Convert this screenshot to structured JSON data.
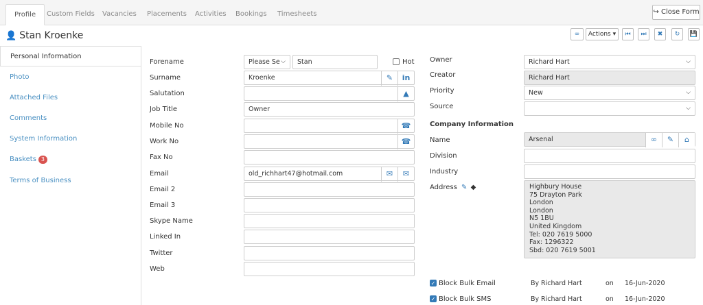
{
  "tabs": [
    "Profile",
    "Custom Fields",
    "Vacancies",
    "Placements",
    "Activities",
    "Bookings",
    "Timesheets"
  ],
  "close_form_label": "Close Form",
  "page_title": "Stan Kroenke",
  "actions_label": "Actions",
  "sidebar": {
    "items": [
      {
        "label": "Personal Information"
      },
      {
        "label": "Photo"
      },
      {
        "label": "Attached Files"
      },
      {
        "label": "Comments"
      },
      {
        "label": "System Information"
      },
      {
        "label": "Baskets",
        "badge": "3"
      },
      {
        "label": "Terms of Business"
      }
    ]
  },
  "form": {
    "forename_label": "Forename",
    "title_select": "Please Se",
    "forename_value": "Stan",
    "hot_label": "Hot",
    "surname_label": "Surname",
    "surname_value": "Kroenke",
    "salutation_label": "Salutation",
    "job_title_label": "Job Title",
    "job_title_value": "Owner",
    "mobile_label": "Mobile No",
    "work_label": "Work No",
    "fax_label": "Fax No",
    "email_label": "Email",
    "email_value": "old_richhart47@hotmail.com",
    "email2_label": "Email 2",
    "email3_label": "Email 3",
    "skype_label": "Skype Name",
    "linkedin_label": "Linked In",
    "twitter_label": "Twitter",
    "web_label": "Web"
  },
  "right": {
    "owner_label": "Owner",
    "owner_value": "Richard Hart",
    "creator_label": "Creator",
    "creator_value": "Richard Hart",
    "priority_label": "Priority",
    "priority_value": "New",
    "source_label": "Source",
    "company_section": "Company Information",
    "name_label": "Name",
    "name_value": "Arsenal",
    "division_label": "Division",
    "industry_label": "Industry",
    "address_label": "Address",
    "address_lines": [
      "Highbury House",
      "75 Drayton Park",
      "London",
      "London",
      "N5 1BU",
      "United Kingdom",
      "Tel: 020 7619 5000",
      "Fax: 1296322",
      "Sbd: 020 7619 5001"
    ],
    "block_email_label": "Block Bulk Email",
    "block_sms_label": "Block Bulk SMS",
    "by_label": "By",
    "by_value": "Richard Hart",
    "on_label": "on",
    "date_value": "16-Jun-2020"
  },
  "colors": {
    "accent": "#337ab7",
    "badge": "#d9534f",
    "link": "#4a90c2"
  }
}
